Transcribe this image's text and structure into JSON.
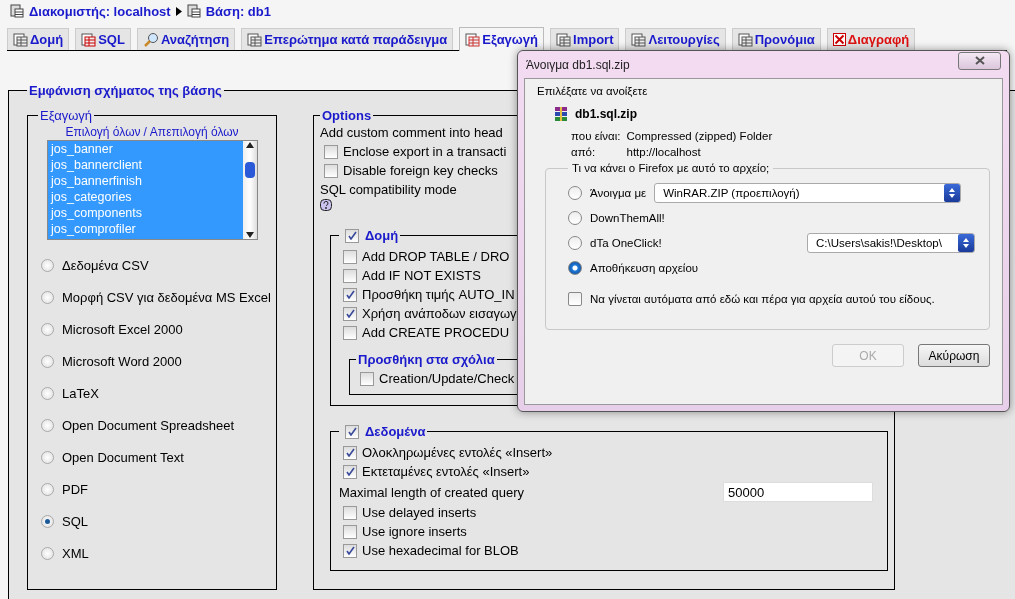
{
  "breadcrumb": [
    {
      "label": "Διακομιστής: localhost"
    },
    {
      "label": "Βάση: db1"
    }
  ],
  "tabs": [
    {
      "label": "Δομή",
      "selected": false,
      "kind": "normal"
    },
    {
      "label": "SQL",
      "selected": false,
      "kind": "normal"
    },
    {
      "label": "Αναζήτηση",
      "selected": false,
      "kind": "normal"
    },
    {
      "label": "Επερώτημα κατά παράδειγμα",
      "selected": false,
      "kind": "normal"
    },
    {
      "label": "Εξαγωγή",
      "selected": true,
      "kind": "normal"
    },
    {
      "label": "Import",
      "selected": false,
      "kind": "normal"
    },
    {
      "label": "Λειτουργίες",
      "selected": false,
      "kind": "normal"
    },
    {
      "label": "Προνόμια",
      "selected": false,
      "kind": "normal"
    },
    {
      "label": "Διαγραφή",
      "selected": false,
      "kind": "danger"
    }
  ],
  "schema_panel": {
    "title": "Εμφάνιση σχήματος της βάσης"
  },
  "export_panel": {
    "title": "Εξαγωγή",
    "links": [
      "Επιλογή όλων",
      "Απεπιλογή όλων"
    ],
    "link_separator": "/",
    "tables": [
      {
        "label": "jos_banner",
        "selected": true
      },
      {
        "label": "jos_bannerclient",
        "selected": true
      },
      {
        "label": "jos_bannerfinish",
        "selected": true
      },
      {
        "label": "jos_categories",
        "selected": true
      },
      {
        "label": "jos_components",
        "selected": true
      },
      {
        "label": "jos_comprofiler",
        "selected": true
      }
    ],
    "formats": [
      {
        "label": "Δεδομένα CSV",
        "selected": false
      },
      {
        "label": "Μορφή CSV για δεδομένα MS Excel",
        "selected": false
      },
      {
        "label": "Microsoft Excel 2000",
        "selected": false
      },
      {
        "label": "Microsoft Word 2000",
        "selected": false
      },
      {
        "label": "LaTeX",
        "selected": false
      },
      {
        "label": "Open Document Spreadsheet",
        "selected": false
      },
      {
        "label": "Open Document Text",
        "selected": false
      },
      {
        "label": "PDF",
        "selected": false
      },
      {
        "label": "SQL",
        "selected": true
      },
      {
        "label": "XML",
        "selected": false
      }
    ]
  },
  "options": {
    "title": "Options",
    "comment_label": "Add custom comment into head",
    "checks": [
      {
        "label": "Enclose export in a transacti",
        "checked": false
      },
      {
        "label": "Disable foreign key checks",
        "checked": false
      }
    ],
    "compat_label": "SQL compatibility mode",
    "structure": {
      "title": "Δομή",
      "checked": true,
      "items": [
        {
          "label": "Add DROP TABLE / DRO",
          "checked": false
        },
        {
          "label": "Add IF NOT EXISTS",
          "checked": false
        },
        {
          "label": "Προσθήκη τιμής AUTO_IN",
          "checked": true
        },
        {
          "label": "Χρήση ανάποδων εισαγωγ",
          "checked": true
        },
        {
          "label": "Add CREATE PROCEDU",
          "checked": false
        }
      ],
      "comments": {
        "title": "Προσθήκη στα σχόλια",
        "items": [
          {
            "label": "Creation/Update/Check",
            "checked": false
          }
        ]
      }
    },
    "data": {
      "title": "Δεδομένα",
      "checked": true,
      "items": [
        {
          "kind": "checkbox",
          "label": "Ολοκληρωμένες εντολές «Insert»",
          "checked": true
        },
        {
          "kind": "checkbox",
          "label": "Εκτεταμένες εντολές «Insert»",
          "checked": true
        },
        {
          "kind": "field",
          "label": "Maximal length of created query",
          "value": "50000"
        },
        {
          "kind": "checkbox",
          "label": "Use delayed inserts",
          "checked": false
        },
        {
          "kind": "checkbox",
          "label": "Use ignore inserts",
          "checked": false
        },
        {
          "kind": "checkbox",
          "label": "Use hexadecimal for BLOB",
          "checked": true
        }
      ]
    }
  },
  "dialog": {
    "title": "Άνοιγμα db1.sql.zip",
    "intro": "Επιλέξατε να ανοίξετε",
    "file_name": "db1.sql.zip",
    "details": [
      {
        "label": "που είναι:",
        "value": "Compressed (zipped) Folder"
      },
      {
        "label": "από:",
        "value": "http://localhost"
      }
    ],
    "group_title": "Τι να κάνει ο Firefox  με αυτό το αρχείο;",
    "actions": [
      {
        "label": "Άνοιγμα με",
        "selected": false,
        "dropdown": "WinRAR.ZIP (προεπιλογή)"
      },
      {
        "label": "DownThemAll!",
        "selected": false
      },
      {
        "label": "dTa OneClick!",
        "selected": false,
        "dropdown": "C:\\Users\\sakis!\\Desktop\\"
      },
      {
        "label": "Αποθήκευση αρχείου",
        "selected": true
      }
    ],
    "remember": {
      "label": "Να γίνεται αυτόματα από εδώ και πέρα για αρχεία αυτού του είδους.",
      "checked": false
    },
    "buttons": [
      {
        "label": "OK",
        "disabled": true
      },
      {
        "label": "Ακύρωση",
        "disabled": false
      }
    ]
  }
}
